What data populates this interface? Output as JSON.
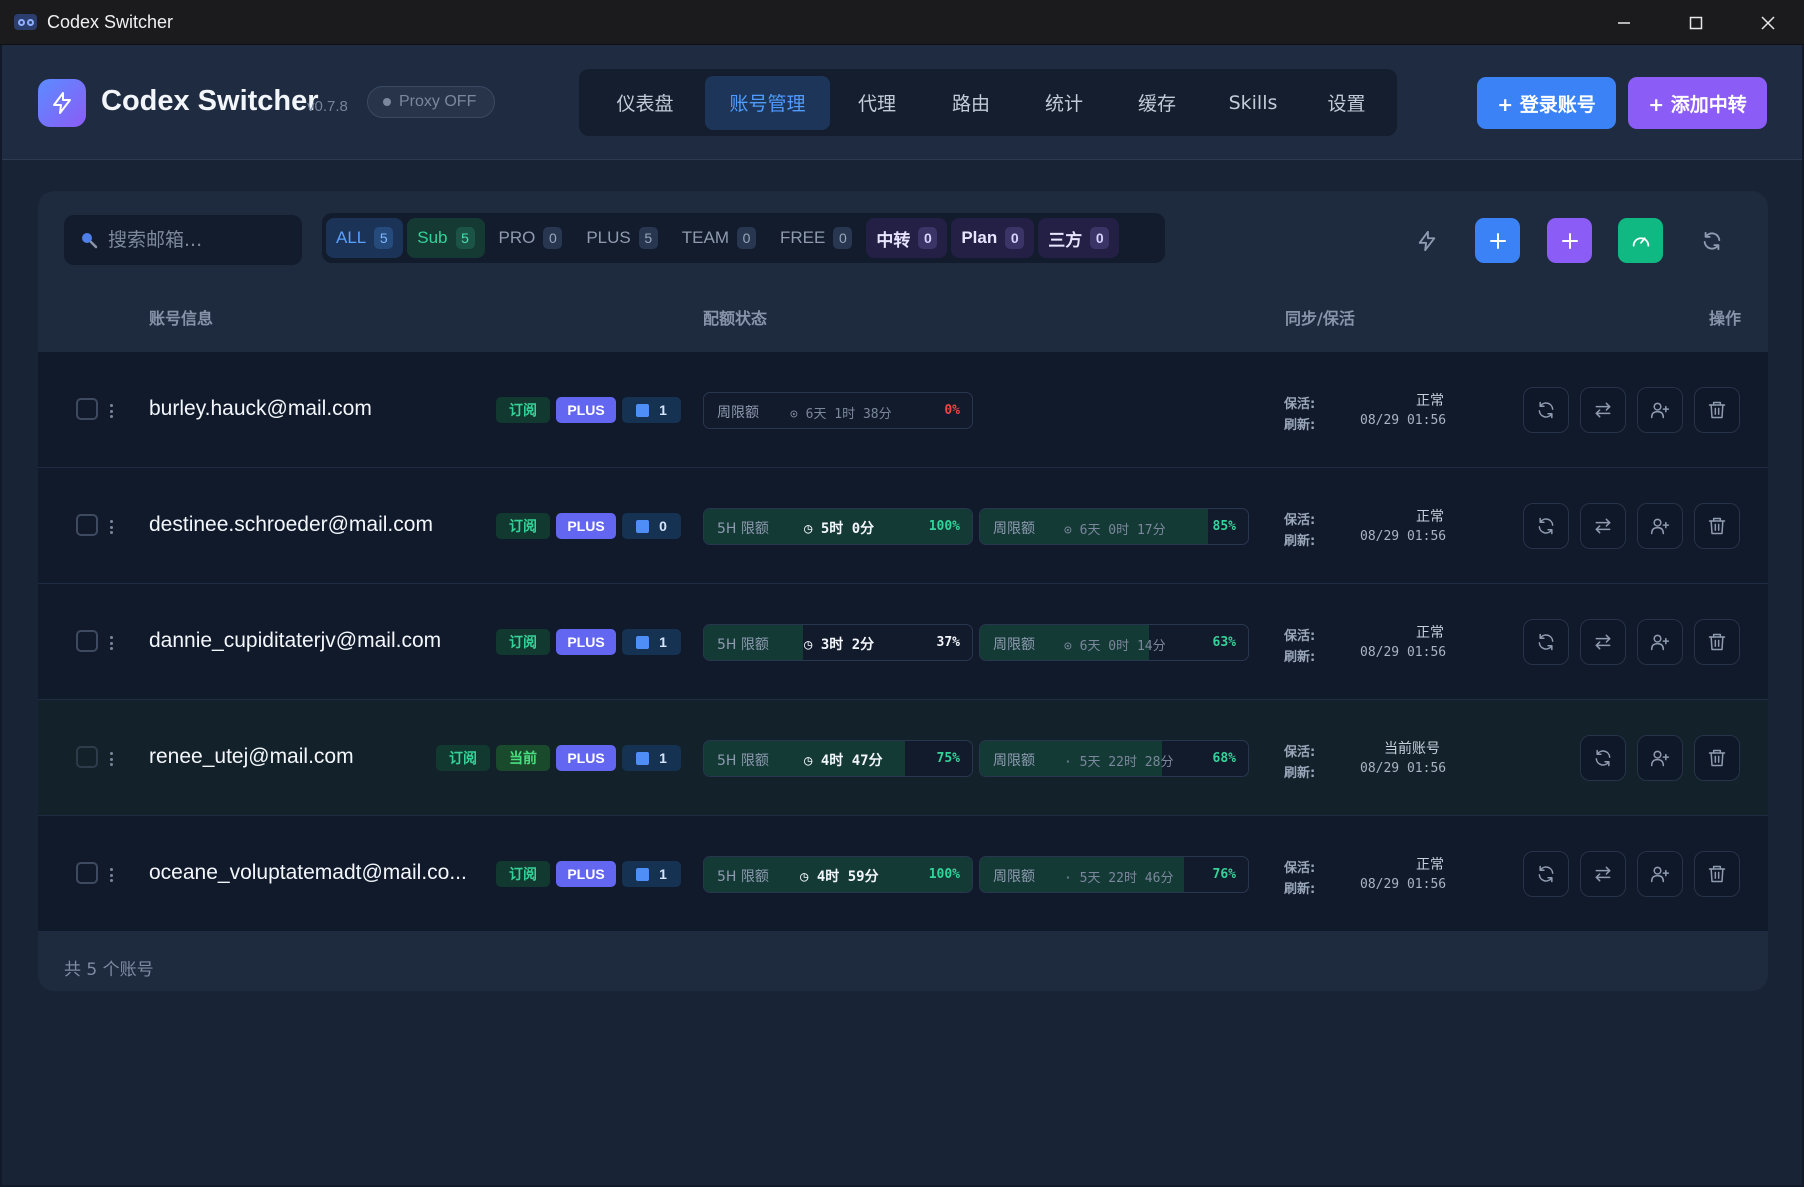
{
  "window": {
    "title": "Codex Switcher"
  },
  "header": {
    "app_name": "Codex Switcher",
    "version": "v0.7.8",
    "proxy_status": "Proxy OFF",
    "nav": [
      {
        "label": "仪表盘"
      },
      {
        "label": "账号管理",
        "active": true
      },
      {
        "label": "代理"
      },
      {
        "label": "路由"
      },
      {
        "label": "统计"
      },
      {
        "label": "缓存"
      },
      {
        "label": "Skills"
      },
      {
        "label": "设置"
      }
    ],
    "login_button": "+ 登录账号",
    "add_relay_button": "+ 添加中转"
  },
  "search": {
    "placeholder": "搜索邮箱..."
  },
  "filters": [
    {
      "label": "ALL",
      "count": "5"
    },
    {
      "label": "Sub",
      "count": "5"
    },
    {
      "label": "PRO",
      "count": "0"
    },
    {
      "label": "PLUS",
      "count": "5"
    },
    {
      "label": "TEAM",
      "count": "0"
    },
    {
      "label": "FREE",
      "count": "0"
    },
    {
      "label": "中转",
      "count": "0"
    },
    {
      "label": "Plan",
      "count": "0"
    },
    {
      "label": "三方",
      "count": "0"
    }
  ],
  "columns": {
    "account": "账号信息",
    "quota": "配额状态",
    "sync": "同步/保活",
    "actions": "操作"
  },
  "labels": {
    "sub_badge": "订阅",
    "current_badge": "当前",
    "plus_badge": "PLUS",
    "quota_5h": "5H 限额",
    "quota_week": "周限额",
    "keepalive": "保活:",
    "refresh": "刷新:"
  },
  "accounts": [
    {
      "email": "burley.hauck@mail.com",
      "refresh_count": "1",
      "week": {
        "remaining": "6天 1时 38分",
        "percent": "0%",
        "fill": 0
      },
      "keepalive_status": "正常",
      "refresh_time": "08/29 01:56"
    },
    {
      "email": "destinee.schroeder@mail.com",
      "refresh_count": "0",
      "h5": {
        "remaining": "5时 0分",
        "percent": "100%",
        "fill": 100
      },
      "week": {
        "remaining": "6天 0时 17分",
        "percent": "85%",
        "fill": 85
      },
      "keepalive_status": "正常",
      "refresh_time": "08/29 01:56"
    },
    {
      "email": "dannie_cupiditaterjv@mail.com",
      "refresh_count": "1",
      "h5": {
        "remaining": "3时 2分",
        "percent": "37%",
        "fill": 37
      },
      "week": {
        "remaining": "6天 0时 14分",
        "percent": "63%",
        "fill": 63
      },
      "keepalive_status": "正常",
      "refresh_time": "08/29 01:56"
    },
    {
      "email": "renee_utej@mail.com",
      "current": true,
      "refresh_count": "1",
      "h5": {
        "remaining": "4时 47分",
        "percent": "75%",
        "fill": 75
      },
      "week": {
        "remaining": "5天 22时 28分",
        "percent": "68%",
        "fill": 68
      },
      "keepalive_status": "当前账号",
      "refresh_time": "08/29 01:56"
    },
    {
      "email": "oceane_voluptatemadt@mail.co...",
      "refresh_count": "1",
      "h5": {
        "remaining": "4时 59分",
        "percent": "100%",
        "fill": 100
      },
      "week": {
        "remaining": "5天 22时 46分",
        "percent": "76%",
        "fill": 76
      },
      "keepalive_status": "正常",
      "refresh_time": "08/29 01:56"
    }
  ],
  "footer": {
    "total": "共 5 个账号"
  },
  "colors": {
    "accent_blue": "#3b82f6",
    "accent_purple": "#8b5cf6",
    "accent_green": "#10b981",
    "quota_green": "#34d399",
    "quota_red": "#ef4444"
  }
}
